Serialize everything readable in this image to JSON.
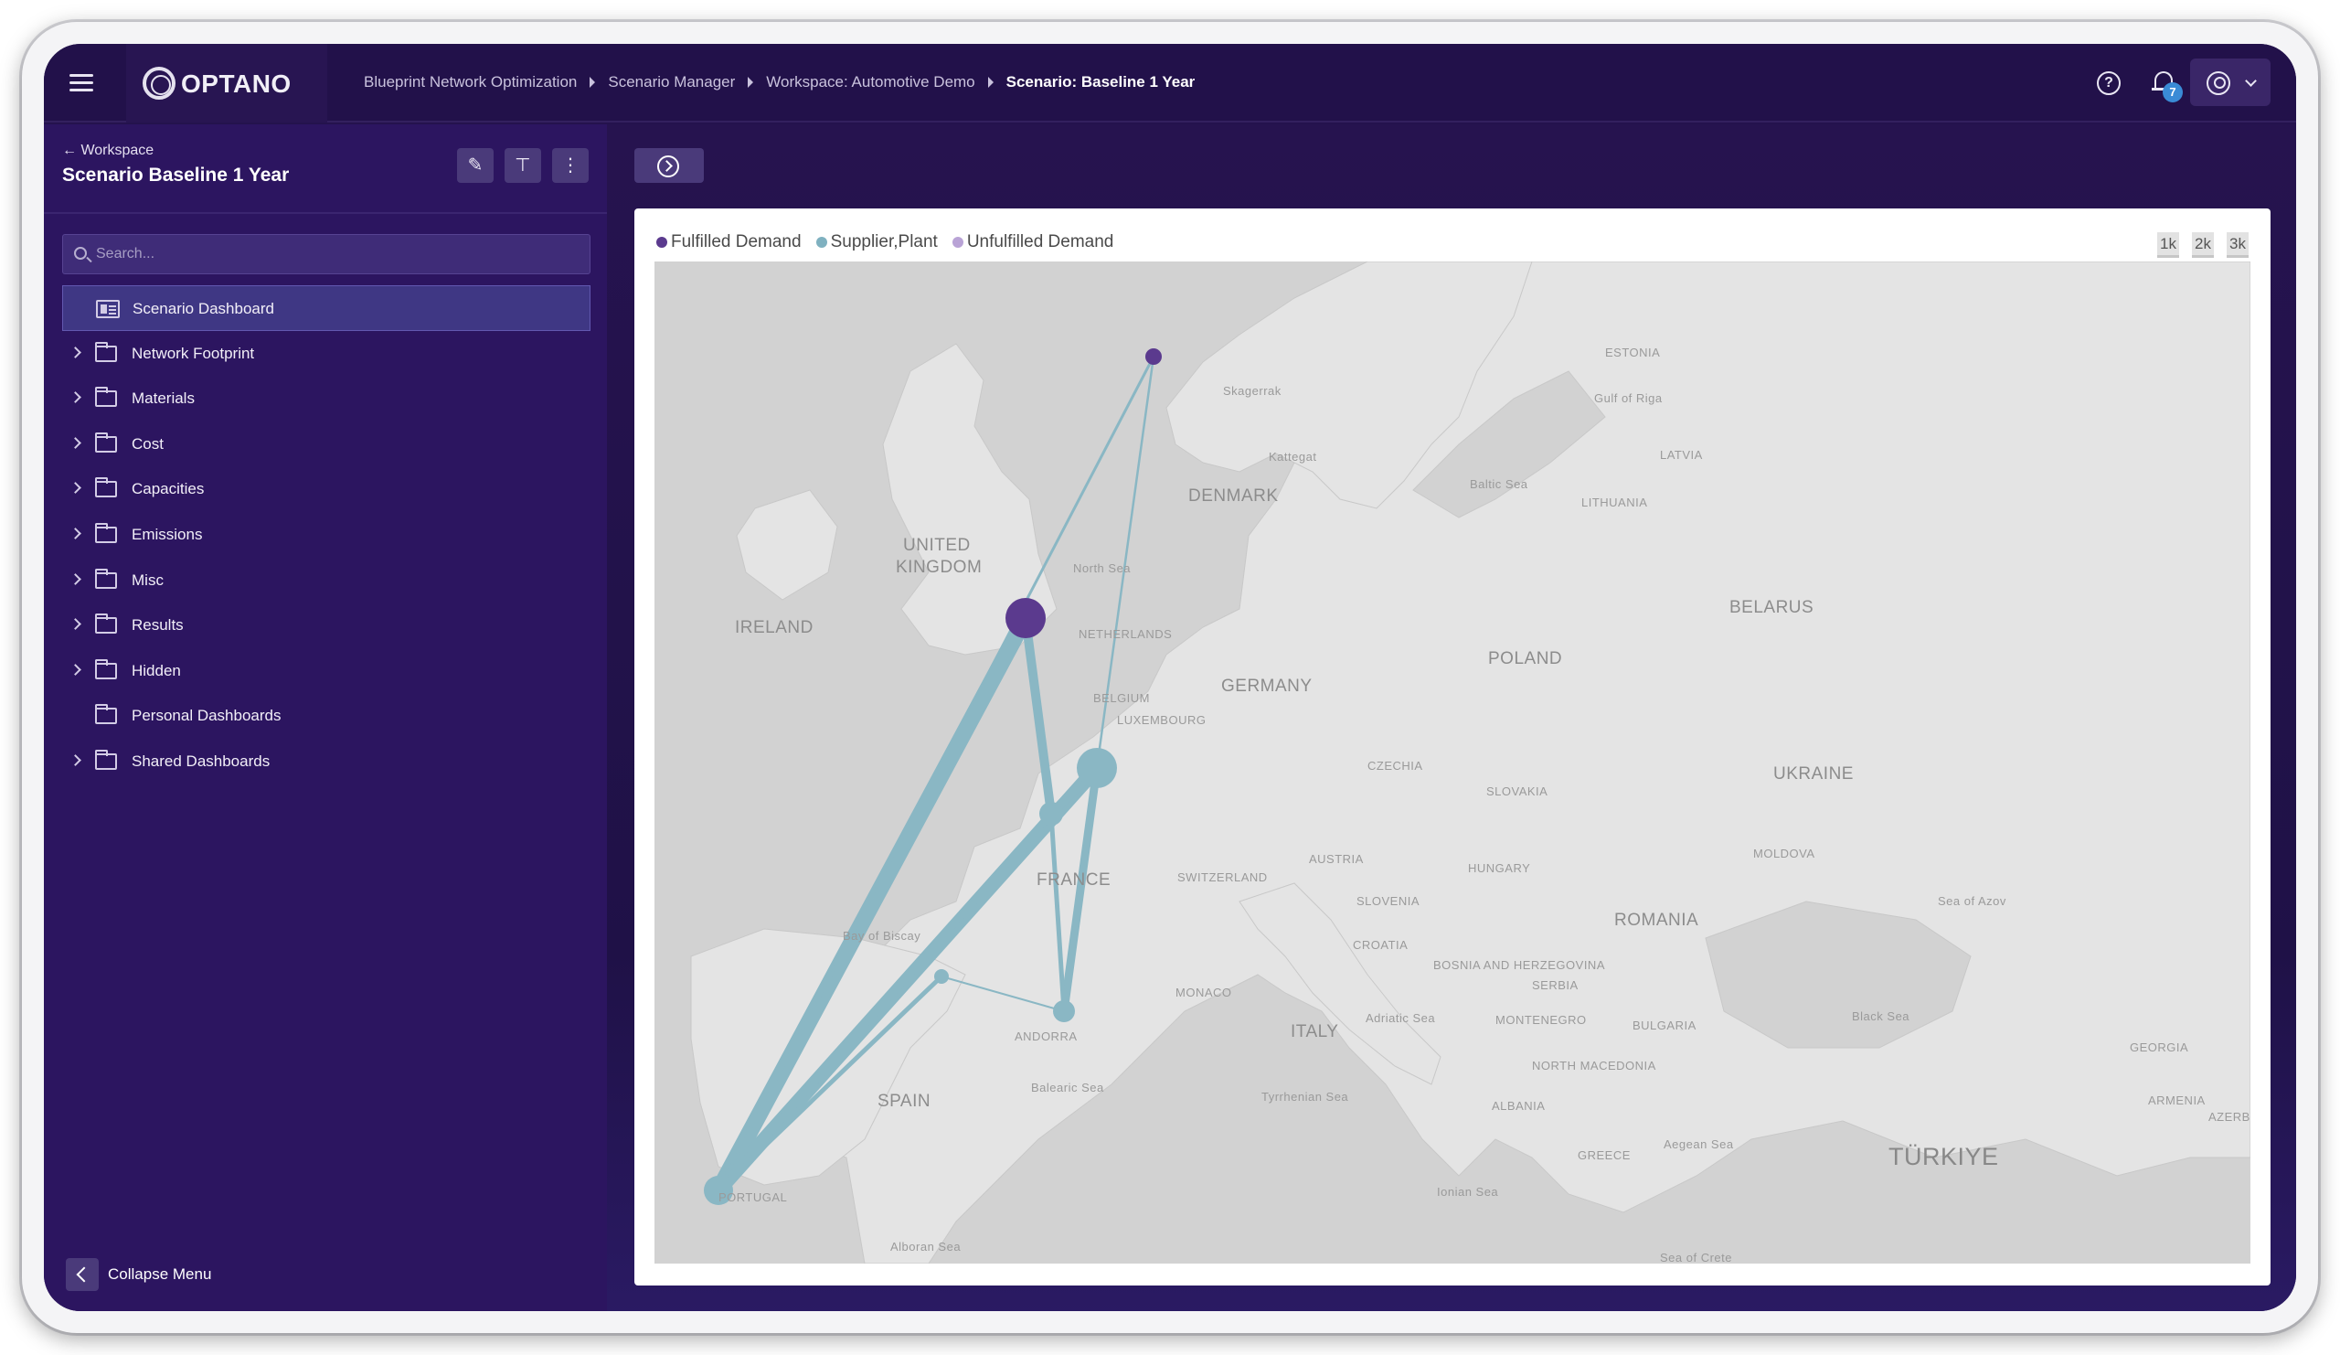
{
  "app": {
    "logo_text": "OPTANO",
    "breadcrumb": [
      "Blueprint Network Optimization",
      "Scenario Manager",
      "Workspace: Automotive Demo",
      "Scenario: Baseline 1 Year"
    ],
    "notification_count": "7",
    "help_glyph": "?"
  },
  "sidebar": {
    "back_label": "Workspace",
    "title": "Scenario Baseline 1 Year",
    "search_placeholder": "Search...",
    "items": [
      {
        "label": "Scenario Dashboard",
        "icon": "dashboard-icon",
        "expandable": false,
        "active": true
      },
      {
        "label": "Network Footprint",
        "icon": "folder-icon",
        "expandable": true
      },
      {
        "label": "Materials",
        "icon": "folder-icon",
        "expandable": true
      },
      {
        "label": "Cost",
        "icon": "folder-icon",
        "expandable": true
      },
      {
        "label": "Capacities",
        "icon": "folder-icon",
        "expandable": true
      },
      {
        "label": "Emissions",
        "icon": "folder-icon",
        "expandable": true
      },
      {
        "label": "Misc",
        "icon": "folder-icon",
        "expandable": true
      },
      {
        "label": "Results",
        "icon": "folder-icon",
        "expandable": true
      },
      {
        "label": "Hidden",
        "icon": "folder-icon",
        "expandable": true
      },
      {
        "label": "Personal Dashboards",
        "icon": "folder-icon",
        "expandable": false
      },
      {
        "label": "Shared Dashboards",
        "icon": "folder-icon",
        "expandable": true
      }
    ],
    "collapse_label": "Collapse Menu"
  },
  "map": {
    "legend": [
      {
        "label": "Fulfilled Demand",
        "color": "#5b3a8e"
      },
      {
        "label": "Supplier,Plant",
        "color": "#7fb1c0"
      },
      {
        "label": "Unfulfilled Demand",
        "color": "#b9a3d6"
      }
    ],
    "zoom_buttons": [
      "1k",
      "2k",
      "3k"
    ],
    "labels": {
      "united_kingdom_1": "UNITED",
      "united_kingdom_2": "KINGDOM",
      "ireland": "IRELAND",
      "denmark": "DENMARK",
      "north_sea": "North Sea",
      "netherlands": "NETHERLANDS",
      "belgium": "BELGIUM",
      "luxembourg": "LUXEMBOURG",
      "germany": "GERMANY",
      "france": "FRANCE",
      "switzerland": "SWITZERLAND",
      "austria": "AUSTRIA",
      "czechia": "CZECHIA",
      "poland": "POLAND",
      "slovakia": "SLOVAKIA",
      "hungary": "HUNGARY",
      "slovenia": "SLOVENIA",
      "croatia": "CROATIA",
      "bosnia": "BOSNIA AND HERZEGOVINA",
      "serbia": "SERBIA",
      "montenegro": "MONTENEGRO",
      "romania": "ROMANIA",
      "bulgaria": "BULGARIA",
      "north_macedonia": "NORTH MACEDONIA",
      "albania": "ALBANIA",
      "greece": "GREECE",
      "turkiye": "TÜRKIYE",
      "ukraine": "UKRAINE",
      "moldova": "MOLDOVA",
      "belarus": "BELARUS",
      "lithuania": "LITHUANIA",
      "latvia": "LATVIA",
      "estonia": "ESTONIA",
      "gulf_of_riga": "Gulf of Riga",
      "baltic_sea": "Baltic Sea",
      "skagerrak": "Skagerrak",
      "kattegat": "Kattegat",
      "bay_of_biscay": "Bay of Biscay",
      "spain": "SPAIN",
      "portugal": "PORTUGAL",
      "andorra": "ANDORRA",
      "monaco": "MONACO",
      "balearic_sea": "Balearic Sea",
      "alboran_sea": "Alboran Sea",
      "tyrrhenian_sea": "Tyrrhenian Sea",
      "adriatic_sea": "Adriatic Sea",
      "ionian_sea": "Ionian Sea",
      "aegean_sea": "Aegean Sea",
      "sea_of_crete": "Sea of Crete",
      "black_sea": "Black Sea",
      "sea_of_azov": "Sea of Azov",
      "georgia": "GEORGIA",
      "armenia": "ARMENIA",
      "azerbaijan": "AZERB",
      "italy": "ITALY"
    }
  }
}
